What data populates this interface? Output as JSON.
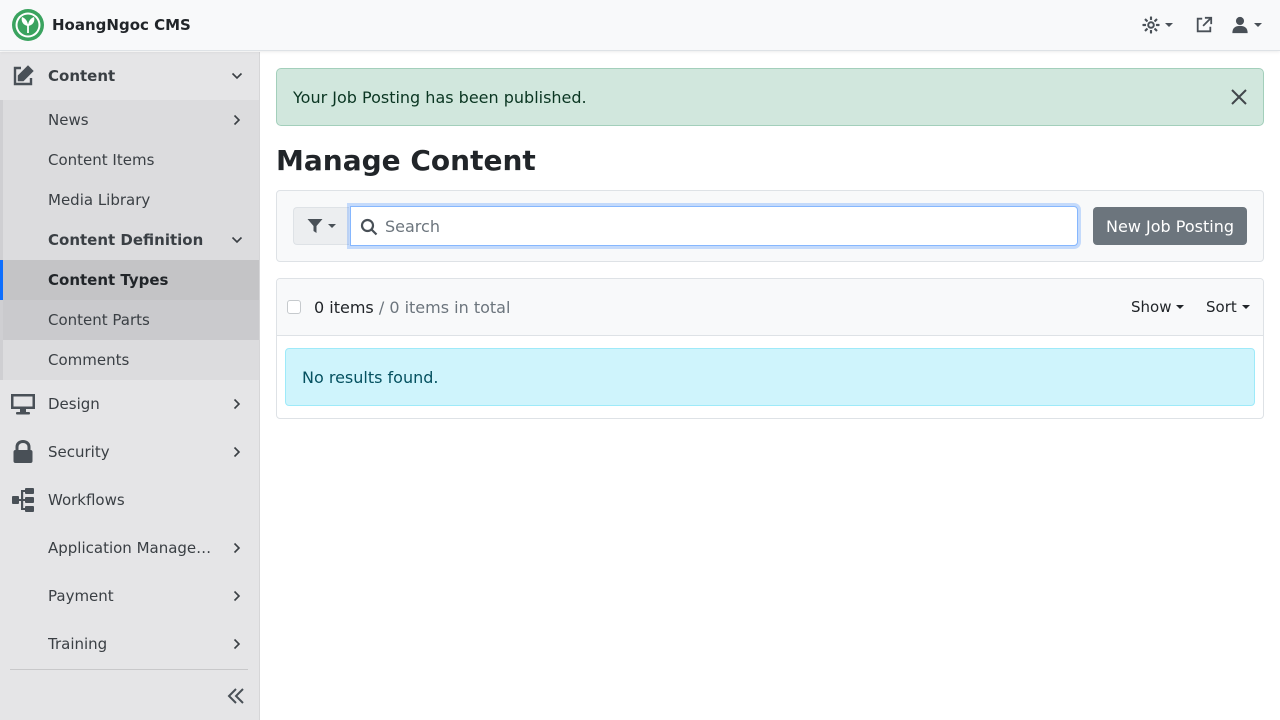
{
  "app": {
    "title": "HoangNgoc CMS"
  },
  "topbar": {
    "theme_icon": "sun-gear-icon",
    "external_icon": "external-link-icon",
    "user_icon": "user-icon"
  },
  "sidebar": {
    "items": [
      {
        "label": "Content",
        "icon": "edit-icon"
      },
      {
        "label": "News"
      },
      {
        "label": "Content Items"
      },
      {
        "label": "Media Library"
      },
      {
        "label": "Content Definition"
      },
      {
        "label": "Content Types"
      },
      {
        "label": "Content Parts"
      },
      {
        "label": "Comments"
      },
      {
        "label": "Design",
        "icon": "monitor-icon"
      },
      {
        "label": "Security",
        "icon": "lock-icon"
      },
      {
        "label": "Workflows",
        "icon": "sitemap-icon"
      },
      {
        "label": "Application Management"
      },
      {
        "label": "Payment"
      },
      {
        "label": "Training"
      }
    ],
    "collapse_icon": "double-chevron-left-icon"
  },
  "alert": {
    "message": "Your Job Posting has been published."
  },
  "page": {
    "title": "Manage Content"
  },
  "search": {
    "placeholder": "Search",
    "value": ""
  },
  "actions": {
    "new_label": "New Job Posting"
  },
  "list": {
    "count_label": "0 items",
    "total_label": "/ 0 items in total",
    "show_label": "Show",
    "sort_label": "Sort",
    "empty_message": "No results found."
  },
  "colors": {
    "accent": "#0d6efd",
    "success_bg": "#d1e7dd",
    "info_bg": "#cff4fc",
    "sidebar_bg": "#e5e5e7",
    "logo_green": "#3aa35f"
  }
}
